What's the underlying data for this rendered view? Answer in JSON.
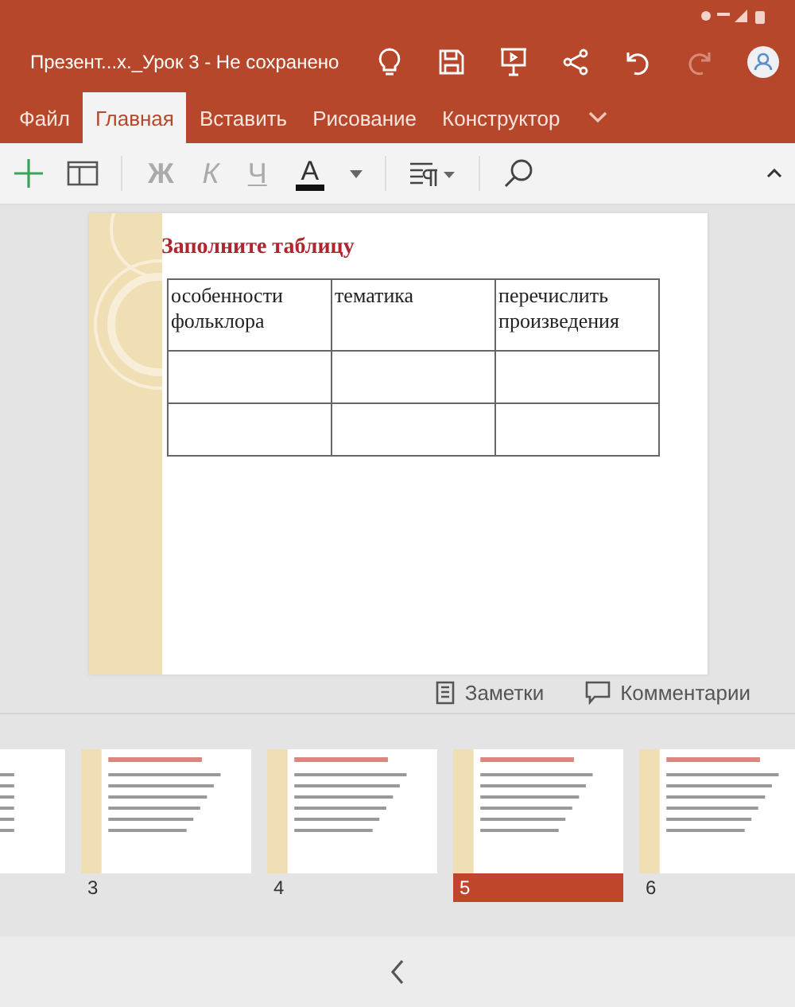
{
  "window": {
    "title": "Презент...х._Урок 3 - Не сохранено"
  },
  "tabs": [
    {
      "label": "Файл",
      "selected": false
    },
    {
      "label": "Главная",
      "selected": true
    },
    {
      "label": "Вставить",
      "selected": false
    },
    {
      "label": "Рисование",
      "selected": false
    },
    {
      "label": "Конструктор",
      "selected": false
    }
  ],
  "format_buttons": [
    {
      "label": "Ж",
      "kind": "bold",
      "disabled": true
    },
    {
      "label": "К",
      "kind": "italic",
      "disabled": true
    },
    {
      "label": "Ч",
      "kind": "underline",
      "disabled": true
    },
    {
      "label": "А",
      "kind": "color",
      "disabled": false
    }
  ],
  "slide": {
    "title": "Заполните таблицу",
    "table": {
      "columns": [
        "особенности фольклора",
        "тематика",
        "перечислить произведения"
      ],
      "rows": [
        [
          "",
          "",
          ""
        ],
        [
          "",
          "",
          ""
        ]
      ]
    }
  },
  "notes_bar": {
    "notes": "Заметки",
    "comments": "Комментарии"
  },
  "thumbnails": [
    {
      "selected": false
    },
    {
      "number": "3",
      "selected": false
    },
    {
      "number": "4",
      "selected": false
    },
    {
      "number": "5",
      "selected": true
    },
    {
      "number": "6",
      "selected": false
    }
  ]
}
